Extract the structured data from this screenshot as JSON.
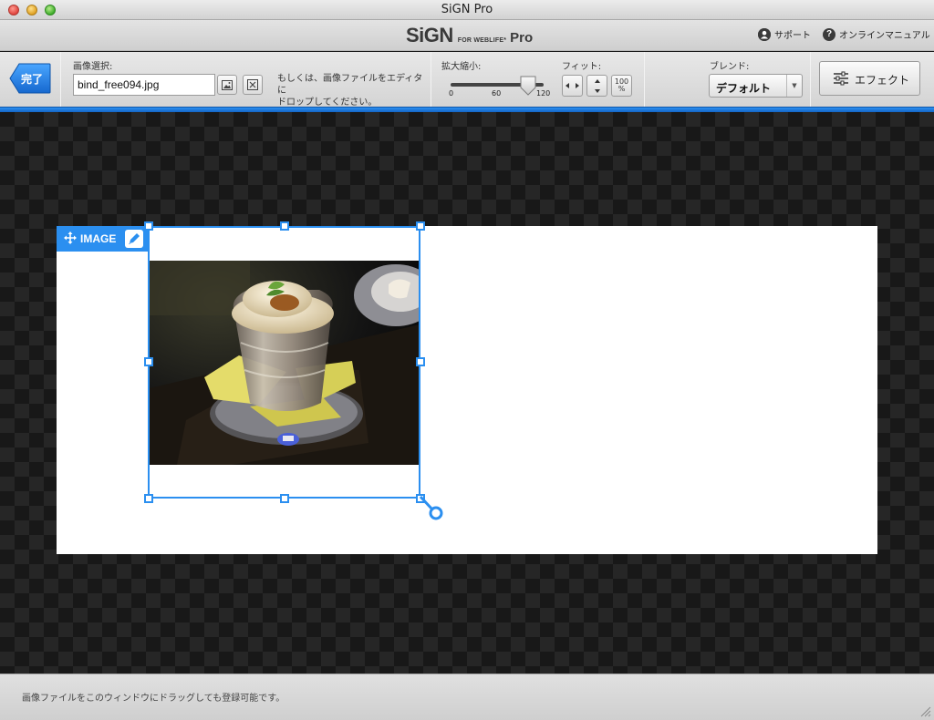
{
  "window": {
    "title": "SiGN Pro"
  },
  "brand": {
    "logo_main": "SiGN",
    "logo_small": "FOR WEBLIFE*",
    "logo_pro": "Pro"
  },
  "header_links": {
    "support": "サポート",
    "manual": "オンラインマニュアル"
  },
  "toolbar": {
    "done_label": "完了",
    "image_select_label": "画像選択:",
    "file_value": "bind_free094.jpg",
    "hint_line1": "もしくは、画像ファイルをエディタに",
    "hint_line2": "ドロップしてください。",
    "zoom_label": "拡大縮小:",
    "zoom": {
      "min": "0",
      "mid": "60",
      "max": "120",
      "value": 100
    },
    "fit_label": "フィット:",
    "fit_100_top": "100",
    "fit_100_bottom": "%",
    "blend_label": "ブレンド:",
    "blend_value": "デフォルト",
    "effect_label": "エフェクト"
  },
  "canvas": {
    "image_tag_label": "IMAGE"
  },
  "status": {
    "text": "画像ファイルをこのウィンドウにドラッグしても登録可能です。"
  },
  "colors": {
    "accent": "#2b8ff0",
    "checker_dark": "#181818",
    "checker_light": "#262626"
  }
}
